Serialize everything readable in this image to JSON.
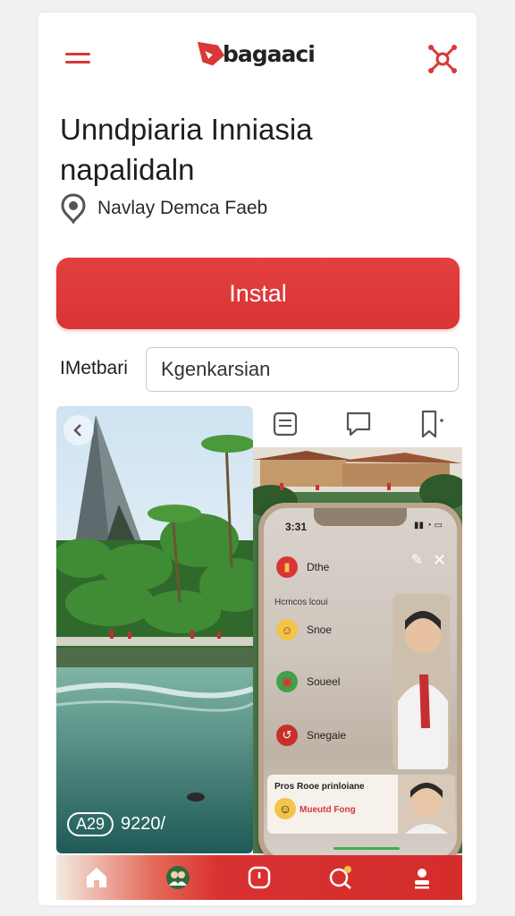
{
  "header": {
    "logo_text": "bagaaci"
  },
  "app": {
    "title": "Unndpiaria Inniasia napalidaln",
    "developer": "Navlay Demca Faeb"
  },
  "install": {
    "label": "Instal"
  },
  "field": {
    "label": "IMetbari",
    "value": "Kgenkarsian"
  },
  "gallery": {
    "caption_badge": "A29",
    "caption_text": "9220/"
  },
  "phone": {
    "time": "3:31",
    "status_icons": "▮▮ ◔ ▭",
    "header": "Hcmcos lcoui",
    "items": [
      {
        "label": "Dthe",
        "icon": "record-icon"
      },
      {
        "label": "Snoe",
        "icon": "smiley-icon"
      },
      {
        "label": "Soueel",
        "icon": "camera-icon"
      },
      {
        "label": "Snegaie",
        "icon": "heart-icon"
      }
    ],
    "banner_title": "Pros Rooe prinloiane",
    "banner_sub": "Mueutd Fong"
  },
  "colors": {
    "accent": "#d93434",
    "background": "#f1f1f3"
  },
  "bottom_nav": [
    {
      "name": "home",
      "icon": "home-icon"
    },
    {
      "name": "community",
      "icon": "people-icon"
    },
    {
      "name": "timer",
      "icon": "clock-icon"
    },
    {
      "name": "search",
      "icon": "search-icon"
    },
    {
      "name": "profile",
      "icon": "person-icon"
    }
  ]
}
